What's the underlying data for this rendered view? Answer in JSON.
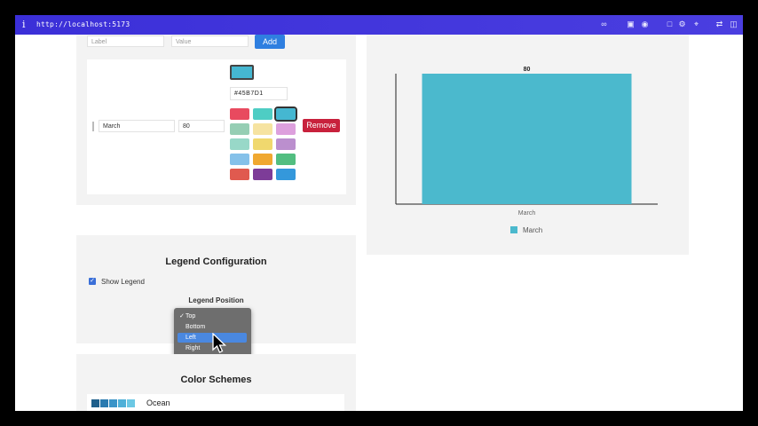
{
  "browser": {
    "info_glyph": "i",
    "url": "http://localhost:5173"
  },
  "data_entry": {
    "label_placeholder": "Label",
    "value_placeholder": "Value",
    "add_label": "Add",
    "row": {
      "label": "March",
      "value": "80",
      "color_value": "#45B7D1",
      "remove_label": "Remove"
    },
    "palette": [
      "#e84a5f",
      "#4ecdc4",
      "#45b7d1",
      "#96ceb4",
      "#f6e3a1",
      "#dda0dd",
      "#98d8c8",
      "#f0d86e",
      "#bb8fce",
      "#85c1e9",
      "#f0a830",
      "#52be80",
      "#e05a4f",
      "#7d3c98",
      "#3498db"
    ]
  },
  "chart_data": {
    "type": "bar",
    "categories": [
      "March"
    ],
    "series": [
      {
        "name": "March",
        "values": [
          80
        ]
      }
    ],
    "data_labels": [
      "80"
    ],
    "ylim": [
      0,
      80
    ],
    "grid": false,
    "legend": "bottom",
    "colors": [
      "#4bb9cd"
    ]
  },
  "legend_config": {
    "title": "Legend Configuration",
    "show_legend_label": "Show Legend",
    "show_legend_checked": true,
    "position_label": "Legend Position",
    "options": [
      "Top",
      "Bottom",
      "Left",
      "Right"
    ],
    "selected": "Top",
    "highlighted": "Left"
  },
  "color_schemes": {
    "title": "Color Schemes",
    "first_scheme": {
      "name": "Ocean",
      "colors": [
        "#1f5f8b",
        "#2a7ab0",
        "#3a94c8",
        "#4fb0d8",
        "#6cc8e4"
      ]
    }
  },
  "colors": {
    "titlebar": "#3b2fd8",
    "panel_bg": "#f3f3f3",
    "add_button": "#2f7fe0",
    "remove_button": "#c8213c",
    "bar": "#4bb9cd"
  }
}
